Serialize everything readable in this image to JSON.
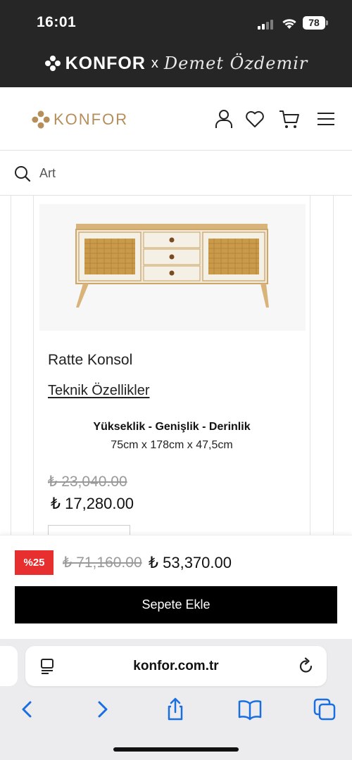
{
  "status_bar": {
    "time": "16:01",
    "battery": "78"
  },
  "promo": {
    "brand": "KONFOR",
    "separator": "x",
    "collab": "Demet Özdemir"
  },
  "header": {
    "brand": "KONFOR",
    "icons": [
      "user-icon",
      "heart-icon",
      "cart-icon",
      "menu-icon"
    ],
    "brand_color": "#b58e5a"
  },
  "search": {
    "placeholder": "Art"
  },
  "product": {
    "name": "Ratte Konsol",
    "spec_link": "Teknik Özellikler",
    "spec_title": "Yükseklik - Genişlik - Derinlik",
    "spec_value": "75cm x 178cm x 47,5cm",
    "old_price": "₺ 23,040.00",
    "price": "₺ 17,280.00"
  },
  "sticky_bar": {
    "discount_badge": "%25",
    "old_total": "₺ 71,160.00",
    "total": "₺ 53,370.00",
    "add_to_cart": "Sepete Ekle",
    "badge_color": "#e82f2f"
  },
  "browser": {
    "url": "konfor.com.tr",
    "toolbar_icons": [
      "back-icon",
      "forward-icon",
      "share-icon",
      "bookmarks-icon",
      "tabs-icon"
    ],
    "accent": "#1a6fe0"
  }
}
